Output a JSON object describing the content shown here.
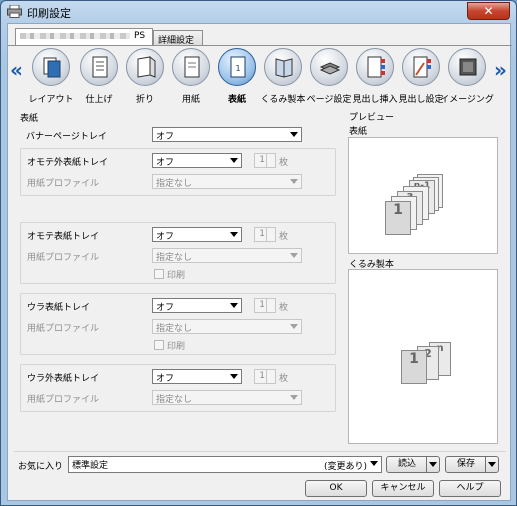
{
  "window": {
    "title": "印刷設定",
    "close_label": "✕"
  },
  "tabs": [
    {
      "label": "PS",
      "active": true
    },
    {
      "label": "詳細設定",
      "active": false
    }
  ],
  "toolbar": {
    "prev_arrow": "«",
    "next_arrow": "»",
    "functions": [
      {
        "label": "レイアウト",
        "icon": "layout-icon",
        "active": false
      },
      {
        "label": "仕上げ",
        "icon": "finishing-icon",
        "active": false
      },
      {
        "label": "折り",
        "icon": "fold-icon",
        "active": false
      },
      {
        "label": "用紙",
        "icon": "paper-icon",
        "active": false
      },
      {
        "label": "表紙",
        "icon": "cover-icon",
        "active": true
      },
      {
        "label": "くるみ製本",
        "icon": "perfect-binding-icon",
        "active": false
      },
      {
        "label": "ページ設定",
        "icon": "page-setup-icon",
        "active": false
      },
      {
        "label": "見出し挿入",
        "icon": "tab-insert-icon",
        "active": false
      },
      {
        "label": "見出し設定",
        "icon": "tab-setting-icon",
        "active": false
      },
      {
        "label": "イメージング",
        "icon": "imaging-icon",
        "active": false
      }
    ]
  },
  "cover": {
    "section_title": "表紙",
    "banner_tray": {
      "label": "バナーページトレイ",
      "value": "オフ"
    },
    "front_outer": {
      "label": "オモテ外表紙トレイ",
      "value": "オフ",
      "count": "1",
      "unit": "枚",
      "profile_label": "用紙プロファイル",
      "profile_value": "指定なし"
    },
    "front": {
      "label": "オモテ表紙トレイ",
      "value": "オフ",
      "count": "1",
      "unit": "枚",
      "profile_label": "用紙プロファイル",
      "profile_value": "指定なし",
      "print_label": "印刷"
    },
    "back": {
      "label": "ウラ表紙トレイ",
      "value": "オフ",
      "count": "1",
      "unit": "枚",
      "profile_label": "用紙プロファイル",
      "profile_value": "指定なし",
      "print_label": "印刷"
    },
    "back_outer": {
      "label": "ウラ外表紙トレイ",
      "value": "オフ",
      "count": "1",
      "unit": "枚",
      "profile_label": "用紙プロファイル",
      "profile_value": "指定なし"
    }
  },
  "preview": {
    "title": "プレビュー",
    "cover_label": "表紙",
    "cover_pages": [
      "1",
      "3",
      "n-1"
    ],
    "binding_label": "くるみ製本",
    "binding_pages": [
      "1",
      "2",
      "n"
    ]
  },
  "favorites": {
    "label": "お気に入り",
    "value": "標準設定",
    "status": "(変更あり)",
    "load_label": "読込",
    "save_label": "保存"
  },
  "buttons": {
    "ok": "OK",
    "cancel": "キャンセル",
    "help": "ヘルプ"
  }
}
